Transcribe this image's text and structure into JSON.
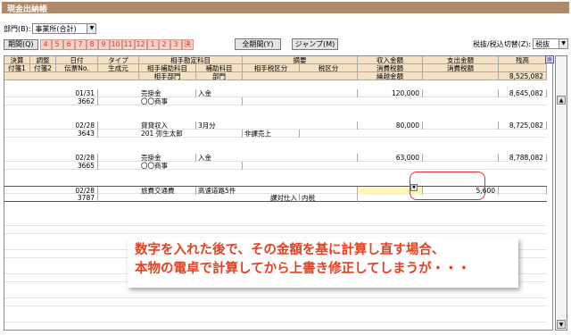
{
  "window": {
    "title": "現金出納帳"
  },
  "dept": {
    "label": "部門(B):",
    "value": "事業所(合計)"
  },
  "period": {
    "button": "期間(Q)",
    "months": [
      "4",
      "5",
      "6",
      "7",
      "8",
      "9",
      "10",
      "11",
      "12",
      "1",
      "2",
      "3",
      "決"
    ],
    "all_button": "全期間(Y)",
    "jump_button": "ジャンプ(M)"
  },
  "tax": {
    "label": "税抜/税込切替(Z):",
    "value": "税抜"
  },
  "headers": {
    "row1": [
      "決算",
      "調整",
      "日付",
      "タイプ",
      "相手勘定科目",
      "摘要",
      "収入金額",
      "支出金額",
      "残高"
    ],
    "row2": [
      "付箋1",
      "付箋2",
      "伝票No.",
      "生成元",
      "相手補助科目",
      "補助科目",
      "相手税区分",
      "税区分",
      "消費税額",
      "消費税額"
    ],
    "row3": [
      "相手部門",
      "部門",
      "繰越金額",
      "8,525,082"
    ]
  },
  "rows": [
    {
      "date": "01/31",
      "account": "売掛金",
      "memo": "入金",
      "income": "120,000",
      "expense": "",
      "balance": "8,645,082",
      "no": "3662",
      "sub": "〇〇商事",
      "taxsub": "",
      "taxcls": ""
    },
    {
      "date": "02/28",
      "account": "貸貸収入",
      "memo": "3月分",
      "income": "80,000",
      "expense": "",
      "balance": "8,725,082",
      "no": "3643",
      "sub": "201 弥生太郎",
      "taxsub": "非課売上",
      "taxcls": ""
    },
    {
      "date": "02/28",
      "account": "売掛金",
      "memo": "入金",
      "income": "63,000",
      "expense": "",
      "balance": "8,788,082",
      "no": "3665",
      "sub": "〇〇商事",
      "taxsub": "",
      "taxcls": ""
    },
    {
      "date": "02/28",
      "account": "旅費交通費",
      "memo": "高速道路5件",
      "income": "",
      "expense": "5,600",
      "balance": "",
      "no": "3787",
      "sub": "",
      "taxsub": "課対仕入",
      "taxcls": "内税"
    }
  ],
  "callout": {
    "line1": "数字を入れた後で、その金額を基に計算し直す場合、",
    "line2": "本物の電卓で計算してから上書き修正してしまうが・・・"
  },
  "colors": {
    "title_bar": "#b0896a",
    "header_bg": "#f4e2c6",
    "month_bg": "#f6d2c4",
    "callout_text": "#e8401f",
    "highlight_box": "#e03030"
  }
}
